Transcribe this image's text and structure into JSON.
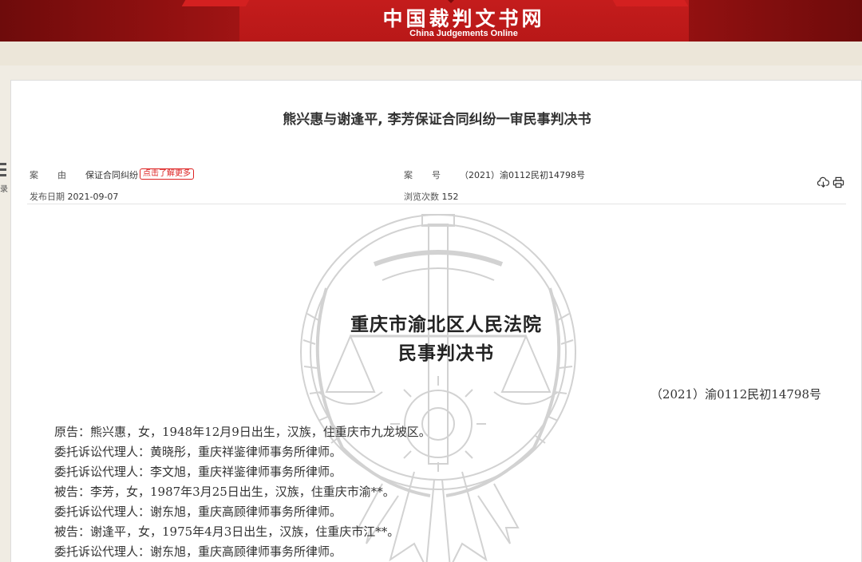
{
  "site": {
    "title": "中国裁判文书网",
    "subtitle": "China Judgements Online"
  },
  "side_nav": {
    "label": "录"
  },
  "document": {
    "title": "熊兴惠与谢逢平, 李芳保证合同纠纷一审民事判决书",
    "meta": {
      "cause_label": "案由",
      "cause_value": "保证合同纠纷",
      "learn_more": "点击了解更多",
      "case_no_label": "案号",
      "case_no_value": "（2021）渝0112民初14798号",
      "publish_date_label": "发布日期",
      "publish_date_value": "2021-09-07",
      "views_label": "浏览次数",
      "views_value": "152"
    },
    "toolbar": {
      "download_icon": "cloud-download-icon",
      "print_icon": "printer-icon"
    },
    "court_name": "重庆市渝北区人民法院",
    "doc_type": "民事判决书",
    "case_number": "（2021）渝0112民初14798号",
    "parties": [
      "原告：熊兴惠，女，1948年12月9日出生，汉族，住重庆市九龙坡区。",
      "委托诉讼代理人：黄晓彤，重庆祥鉴律师事务所律师。",
      "委托诉讼代理人：李文旭，重庆祥鉴律师事务所律师。",
      "被告：李芳，女，1987年3月25日出生，汉族，住重庆市渝**。",
      "委托诉讼代理人：谢东旭，重庆高顾律师事务所律师。",
      "被告：谢逢平，女，1975年4月3日出生，汉族，住重庆市江**。",
      "委托诉讼代理人：谢东旭，重庆高顾律师事务所律师。"
    ]
  },
  "colors": {
    "banner_red": "#b81818",
    "banner_dark": "#6e0b0b",
    "accent_red": "#dd2222",
    "page_bg": "#f0ece3"
  }
}
